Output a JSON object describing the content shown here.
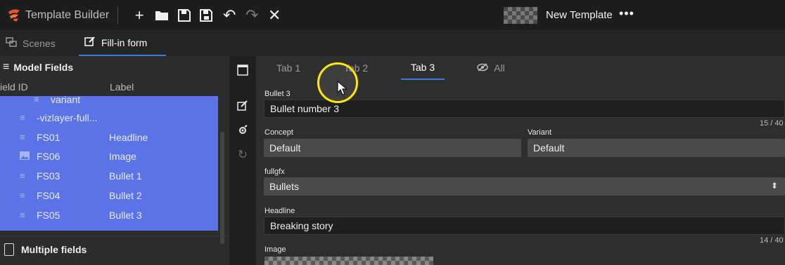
{
  "app": {
    "title": "Template Builder",
    "icon": "app-logo-icon"
  },
  "toolbar": {
    "buttons": [
      {
        "name": "add-button",
        "icon": "plus-icon",
        "glyph": "+"
      },
      {
        "name": "open-button",
        "icon": "folder-icon",
        "glyph": "▰"
      },
      {
        "name": "save-button",
        "icon": "save-icon",
        "glyph": "🖫"
      },
      {
        "name": "save-as-button",
        "icon": "save-as-icon",
        "glyph": "🖫"
      },
      {
        "name": "undo-button",
        "icon": "undo-icon",
        "glyph": "↶"
      },
      {
        "name": "redo-button",
        "icon": "redo-icon",
        "glyph": "↷"
      },
      {
        "name": "close-button",
        "icon": "close-icon",
        "glyph": "✕"
      }
    ]
  },
  "template": {
    "name": "New Template",
    "more": "•••"
  },
  "subtabs": {
    "scenes": "Scenes",
    "fill_in": "Fill-in form"
  },
  "left_panel": {
    "title": "Model Fields",
    "columns": {
      "field_id": "ield ID",
      "label": "Label"
    },
    "rows": [
      {
        "id": "variant",
        "label": ""
      },
      {
        "id": "-vizlayer-full...",
        "label": ""
      },
      {
        "id": "FS01",
        "label": "Headline"
      },
      {
        "id": "FS06",
        "label": "Image"
      },
      {
        "id": "FS03",
        "label": "Bullet 1"
      },
      {
        "id": "FS04",
        "label": "Bullet 2"
      },
      {
        "id": "FS05",
        "label": "Bullet 3"
      }
    ],
    "multiple_fields": "Multiple fields"
  },
  "tabs": [
    {
      "label": "Tab 1"
    },
    {
      "label": "Tab 2"
    },
    {
      "label": "Tab 3"
    },
    {
      "label": "All"
    }
  ],
  "form": {
    "bullet3": {
      "label": "Bullet 3",
      "value": "Bullet number 3",
      "counter": "15 / 40"
    },
    "concept": {
      "label": "Concept",
      "value": "Default"
    },
    "variant": {
      "label": "Variant",
      "value": "Default"
    },
    "fullgfx": {
      "label": "fullgfx",
      "value": "Bullets",
      "arrow": "⬍"
    },
    "headline": {
      "label": "Headline",
      "value": "Breaking story",
      "counter": "14 / 40"
    },
    "image": {
      "label": "Image"
    }
  },
  "colors": {
    "accent": "#3b7be0",
    "selection": "#5b73e6",
    "highlight": "#ffe900"
  }
}
